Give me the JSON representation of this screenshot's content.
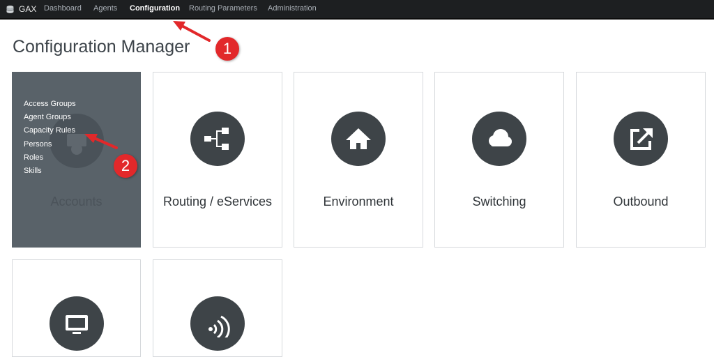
{
  "nav": {
    "brand": "GAX",
    "items": [
      {
        "label": "Dashboard"
      },
      {
        "label": "Agents"
      },
      {
        "label": "Configuration",
        "active": true
      },
      {
        "label": "Routing Parameters"
      },
      {
        "label": "Administration"
      }
    ]
  },
  "page": {
    "title": "Configuration Manager"
  },
  "tiles": [
    {
      "label": "Accounts",
      "icon": "accounts-icon",
      "state": "hovered",
      "submenu": [
        "Access Groups",
        "Agent Groups",
        "Capacity Rules",
        "Persons",
        "Roles",
        "Skills"
      ]
    },
    {
      "label": "Routing / eServices",
      "icon": "routing-icon"
    },
    {
      "label": "Environment",
      "icon": "home-icon"
    },
    {
      "label": "Switching",
      "icon": "cloud-icon"
    },
    {
      "label": "Outbound",
      "icon": "external-link-icon"
    },
    {
      "label": "",
      "icon": "monitor-icon"
    },
    {
      "label": "",
      "icon": "wireless-signal-icon"
    }
  ],
  "annotations": [
    {
      "number": "1"
    },
    {
      "number": "2"
    }
  ],
  "colors": {
    "nav_bg": "#1d1f21",
    "tile_icon": "#3e4448",
    "accounts_bg": "#596269",
    "callout": "#e2282a"
  }
}
